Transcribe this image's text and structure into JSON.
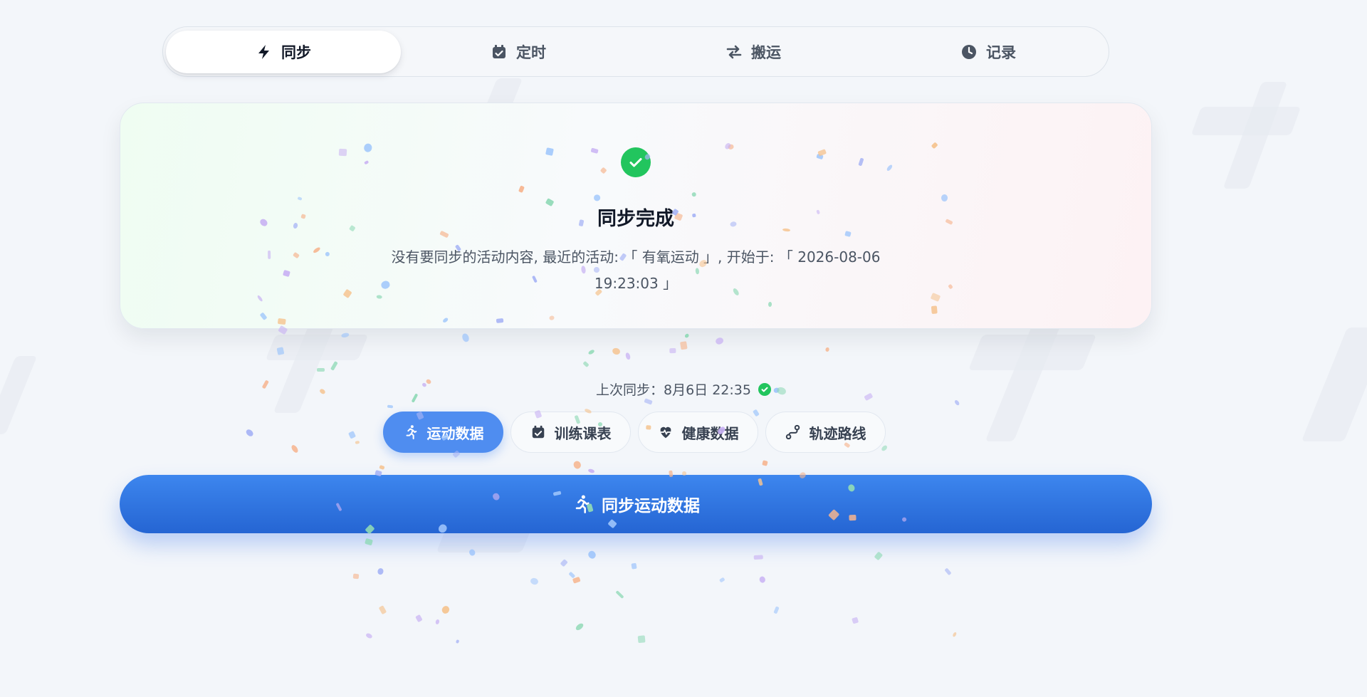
{
  "tabs": [
    {
      "id": "sync",
      "label": "同步",
      "icon": "bolt-icon",
      "active": true
    },
    {
      "id": "schedule",
      "label": "定时",
      "icon": "calendar-check-icon",
      "active": false
    },
    {
      "id": "transfer",
      "label": "搬运",
      "icon": "arrows-exchange-icon",
      "active": false
    },
    {
      "id": "history",
      "label": "记录",
      "icon": "clock-icon",
      "active": false
    }
  ],
  "status_card": {
    "icon": "check-circle-icon",
    "title": "同步完成",
    "message": "没有要同步的活动内容, 最近的活动: 「 有氧运动 」, 开始于: 「 2026-08-06 19:23:03 」"
  },
  "last_sync": {
    "text": "上次同步：8月6日 22:35",
    "status_icon": "check-circle-icon"
  },
  "chips": [
    {
      "label": "运动数据",
      "icon": "running-icon",
      "active": true
    },
    {
      "label": "训练课表",
      "icon": "calendar-check-icon",
      "active": false
    },
    {
      "label": "健康数据",
      "icon": "heartbeat-icon",
      "active": false
    },
    {
      "label": "轨迹路线",
      "icon": "route-icon",
      "active": false
    }
  ],
  "sync_button": {
    "label": "同步运动数据",
    "icon": "running-icon"
  },
  "colors": {
    "accent": "#2f74e4",
    "chip_active": "#4f8df0",
    "success": "#22c55e",
    "background": "#f3f6fa"
  }
}
